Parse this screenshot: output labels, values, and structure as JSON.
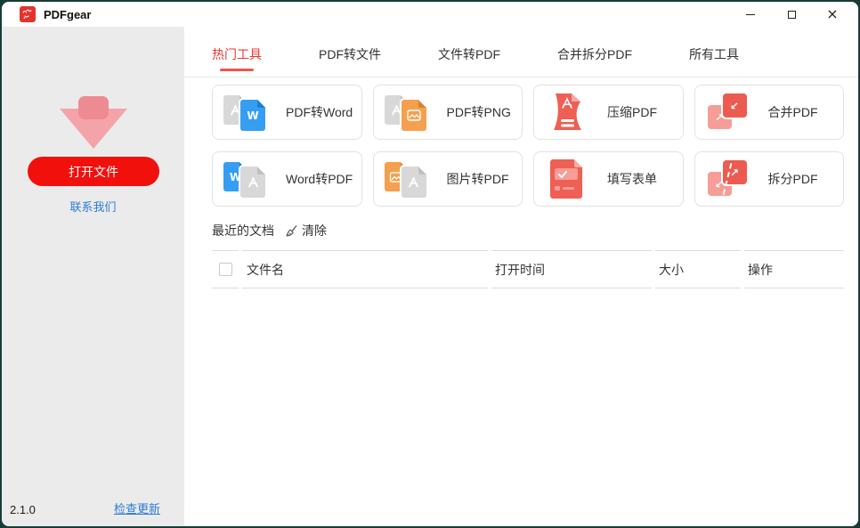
{
  "window": {
    "title": "PDFgear",
    "controls": {
      "minimize": "minimize",
      "maximize": "maximize",
      "close": "×"
    }
  },
  "sidebar": {
    "open_button_label": "打开文件",
    "contact_link_label": "联系我们",
    "version": "2.1.0",
    "update_link_label": "检查更新"
  },
  "tabs": [
    {
      "label": "热门工具",
      "active": true
    },
    {
      "label": "PDF转文件",
      "active": false
    },
    {
      "label": "文件转PDF",
      "active": false
    },
    {
      "label": "合并拆分PDF",
      "active": false
    },
    {
      "label": "所有工具",
      "active": false
    }
  ],
  "tools": [
    {
      "label": "PDF转Word",
      "icon": "pdf-to-word-icon"
    },
    {
      "label": "PDF转PNG",
      "icon": "pdf-to-png-icon"
    },
    {
      "label": "压缩PDF",
      "icon": "compress-pdf-icon"
    },
    {
      "label": "合并PDF",
      "icon": "merge-pdf-icon"
    },
    {
      "label": "Word转PDF",
      "icon": "word-to-pdf-icon"
    },
    {
      "label": "图片转PDF",
      "icon": "image-to-pdf-icon"
    },
    {
      "label": "填写表单",
      "icon": "fill-form-icon"
    },
    {
      "label": "拆分PDF",
      "icon": "split-pdf-icon"
    }
  ],
  "word_letter": "W",
  "recent": {
    "title": "最近的文档",
    "clear_label": "清除",
    "columns": {
      "name": "文件名",
      "time": "打开时间",
      "size": "大小",
      "action": "操作"
    },
    "rows": []
  },
  "colors": {
    "accent_red": "#e6382f",
    "button_red": "#f2100d",
    "link_blue": "#2b7bd6",
    "icon_coral": "#ee5f54",
    "icon_coral_light": "#f59d96",
    "icon_blue": "#359ef3",
    "icon_orange": "#f5a04e",
    "sidebar_bg": "#ebebeb",
    "desktop_border": "#173c38"
  }
}
